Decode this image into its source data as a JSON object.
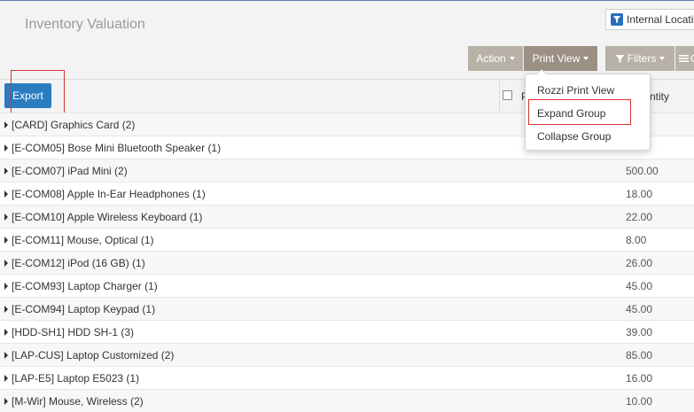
{
  "page": {
    "title": "Inventory Valuation"
  },
  "filter": {
    "label": "Internal Locati"
  },
  "toolbar": {
    "action_label": "Action",
    "print_view_label": "Print View",
    "filters_label": "Filters",
    "group_label": "G"
  },
  "export_label": "Export",
  "table": {
    "col_product_partial": "P",
    "col_quantity_partial": "ntity",
    "rows": [
      {
        "label": "[CARD] Graphics Card (2)",
        "qty": ""
      },
      {
        "label": "[E-COM05] Bose Mini Bluetooth Speaker (1)",
        "qty": ""
      },
      {
        "label": "[E-COM07] iPad Mini (2)",
        "qty": "500.00"
      },
      {
        "label": "[E-COM08] Apple In-Ear Headphones (1)",
        "qty": "18.00"
      },
      {
        "label": "[E-COM10] Apple Wireless Keyboard (1)",
        "qty": "22.00"
      },
      {
        "label": "[E-COM11] Mouse, Optical (1)",
        "qty": "8.00"
      },
      {
        "label": "[E-COM12] iPod (16 GB) (1)",
        "qty": "26.00"
      },
      {
        "label": "[E-COM93] Laptop Charger (1)",
        "qty": "45.00"
      },
      {
        "label": "[E-COM94] Laptop Keypad (1)",
        "qty": "45.00"
      },
      {
        "label": "[HDD-SH1] HDD SH-1 (3)",
        "qty": "39.00"
      },
      {
        "label": "[LAP-CUS] Laptop Customized (2)",
        "qty": "85.00"
      },
      {
        "label": "[LAP-E5] Laptop E5023 (1)",
        "qty": "16.00"
      },
      {
        "label": "[M-Wir] Mouse, Wireless (2)",
        "qty": "10.00"
      }
    ]
  },
  "print_menu": {
    "items": [
      "Rozzi Print View",
      "Expand Group",
      "Collapse Group"
    ]
  },
  "colors": {
    "export_button": "#2a7cc0",
    "toolbar_button": "#b8b1a8",
    "highlight_box": "#d9322f"
  }
}
